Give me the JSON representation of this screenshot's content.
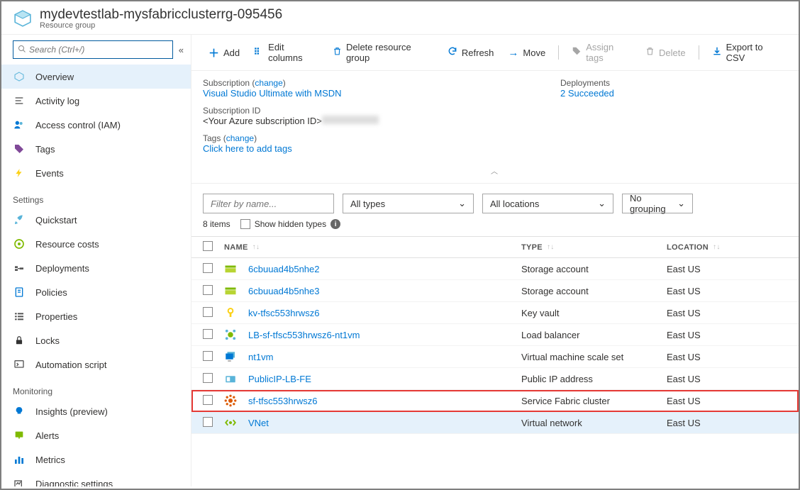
{
  "header": {
    "title": "mydevtestlab-mysfabricclusterrg-095456",
    "subtitle": "Resource group"
  },
  "search": {
    "placeholder": "Search (Ctrl+/)"
  },
  "nav": {
    "overview": "Overview",
    "activity_log": "Activity log",
    "access_control": "Access control (IAM)",
    "tags": "Tags",
    "events": "Events",
    "section_settings": "Settings",
    "quickstart": "Quickstart",
    "resource_costs": "Resource costs",
    "deployments": "Deployments",
    "policies": "Policies",
    "properties": "Properties",
    "locks": "Locks",
    "automation_script": "Automation script",
    "section_monitoring": "Monitoring",
    "insights": "Insights (preview)",
    "alerts": "Alerts",
    "metrics": "Metrics",
    "diagnostic_settings": "Diagnostic settings"
  },
  "toolbar": {
    "add": "Add",
    "edit_columns": "Edit columns",
    "delete_rg": "Delete resource group",
    "refresh": "Refresh",
    "move": "Move",
    "assign_tags": "Assign tags",
    "delete": "Delete",
    "export_csv": "Export to CSV"
  },
  "essentials": {
    "subscription_label": "Subscription",
    "change": "change",
    "subscription_value": "Visual Studio Ultimate with MSDN",
    "subscription_id_label": "Subscription ID",
    "subscription_id_value": "<Your Azure subscription ID>",
    "tags_label": "Tags",
    "tags_value": "Click here to add tags",
    "deployments_label": "Deployments",
    "deployments_value": "2 Succeeded"
  },
  "filters": {
    "filter_placeholder": "Filter by name...",
    "types": "All types",
    "locations": "All locations",
    "grouping": "No grouping"
  },
  "items_meta": {
    "count": "8 items",
    "show_hidden": "Show hidden types"
  },
  "columns": {
    "name": "NAME",
    "type": "TYPE",
    "location": "LOCATION"
  },
  "resources": [
    {
      "name": "6cbuuad4b5nhe2",
      "type": "Storage account",
      "location": "East US",
      "icon": "storage"
    },
    {
      "name": "6cbuuad4b5nhe3",
      "type": "Storage account",
      "location": "East US",
      "icon": "storage"
    },
    {
      "name": "kv-tfsc553hrwsz6",
      "type": "Key vault",
      "location": "East US",
      "icon": "keyvault"
    },
    {
      "name": "LB-sf-tfsc553hrwsz6-nt1vm",
      "type": "Load balancer",
      "location": "East US",
      "icon": "lb"
    },
    {
      "name": "nt1vm",
      "type": "Virtual machine scale set",
      "location": "East US",
      "icon": "vmss"
    },
    {
      "name": "PublicIP-LB-FE",
      "type": "Public IP address",
      "location": "East US",
      "icon": "ip"
    },
    {
      "name": "sf-tfsc553hrwsz6",
      "type": "Service Fabric cluster",
      "location": "East US",
      "icon": "sf"
    },
    {
      "name": "VNet",
      "type": "Virtual network",
      "location": "East US",
      "icon": "vnet"
    }
  ]
}
